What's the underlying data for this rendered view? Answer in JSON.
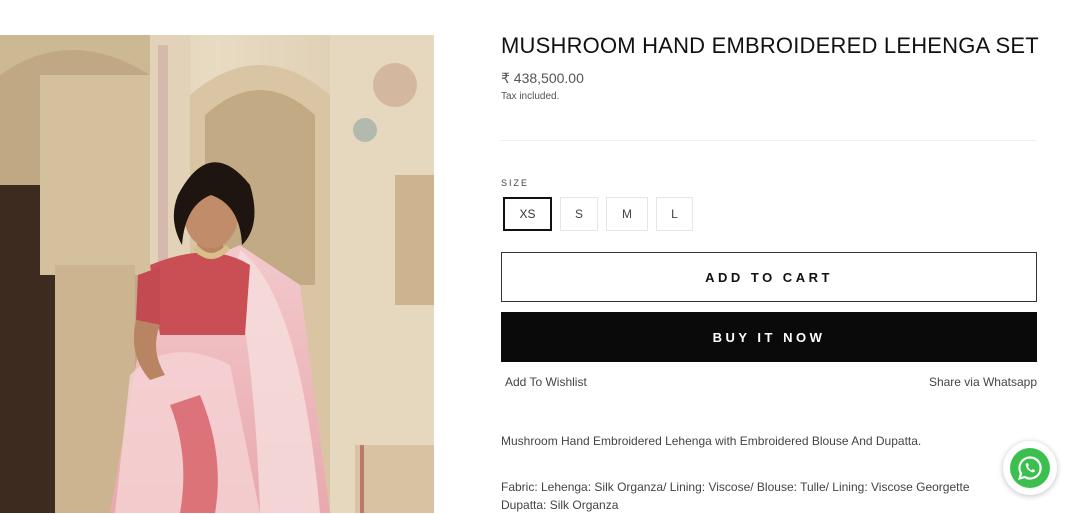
{
  "product": {
    "title": "MUSHROOM HAND EMBROIDERED LEHENGA SET",
    "price": "₹ 438,500.00",
    "tax_note": "Tax included.",
    "image_alt": "Model wearing mushroom pink hand embroidered lehenga set"
  },
  "size": {
    "label": "SIZE",
    "options": [
      "XS",
      "S",
      "M",
      "L"
    ],
    "selected": "XS"
  },
  "actions": {
    "add_to_cart": "ADD TO CART",
    "buy_now": "BUY IT NOW",
    "wishlist": "Add To Wishlist",
    "share": "Share via Whatsapp"
  },
  "description": {
    "summary": "Mushroom Hand Embroidered Lehenga with Embroidered Blouse And Dupatta.",
    "fabric_line1": "Fabric: Lehenga: Silk Organza/ Lining: Viscose/ Blouse: Tulle/ Lining: Viscose Georgette",
    "fabric_line2": "Dupatta: Silk Organza"
  },
  "widgets": {
    "whatsapp_icon": "whatsapp-icon",
    "whatsapp_color": "#3bbf4f"
  },
  "colors": {
    "buy_button_bg": "#0a0a0a",
    "text_primary": "#111111",
    "border": "#e6e6e6"
  }
}
